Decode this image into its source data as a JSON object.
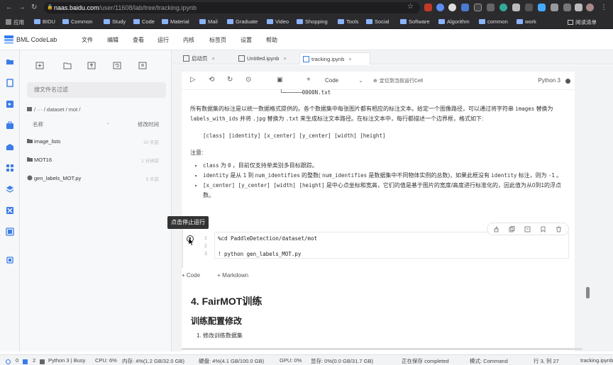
{
  "browser": {
    "url_host": "naas.baidu.com",
    "url_path": "/user/11608/lab/tree/tracking.ipynb",
    "bookmarks": [
      "应用",
      "BIDU",
      "Common",
      "Study",
      "Code",
      "Material",
      "Mail",
      "Graduate",
      "Video",
      "Shopping",
      "Tools",
      "Social",
      "Software",
      "Algorithm",
      "common",
      "work"
    ],
    "reading_list": "阅读清单"
  },
  "app": {
    "title": "BML CodeLab",
    "menu": [
      "文件",
      "编辑",
      "查看",
      "运行",
      "内核",
      "标签页",
      "设置",
      "帮助"
    ]
  },
  "filebrowser": {
    "search_placeholder": "搜文件名过滤",
    "breadcrumb": "/ ··· / dataset / mot /",
    "col_name": "名称",
    "col_modified": "修改时间",
    "items": [
      {
        "name": "image_lists",
        "time": "10 天前"
      },
      {
        "name": "MOT16",
        "time": "1 分钟前"
      },
      {
        "name": "gen_labels_MOT.py",
        "time": "5 天前"
      }
    ]
  },
  "tabs": [
    {
      "label": "启动页"
    },
    {
      "label": "Untitled.ipynb"
    },
    {
      "label": "tracking.ipynb"
    }
  ],
  "toolbar": {
    "cell_type": "Code",
    "run_current": "定位到当前运行Cell",
    "kernel": "Python 3"
  },
  "markdown1": {
    "tree_tail": "└──────0000N.txt",
    "para_a": "所有数据集的标注是以统一数据格式提供的。各个数据集中每张图片都有相应的标注文本。给定一个图像路径，可以通过将字符串",
    "code_images": "images",
    "para_b": "替换为",
    "code_lwi": "labels_with_ids",
    "para_c": "并将",
    "code_jpg": ".jpg",
    "para_d": "替换为",
    "code_txt": ".txt",
    "para_e": "来生成标注文本路径。在标注文本中，每行都描述一个边界框，格式如下:",
    "format_line": "[class] [identity] [x_center] [y_center] [width] [height]",
    "note": "注意:",
    "bullet1_code": "class",
    "bullet1_mid": "为",
    "bullet1_code2": "0",
    "bullet1_tail": "，目前仅支持单类别多目标跟踪。",
    "bullet2_code": "identity",
    "bullet2_a": "是从",
    "bullet2_code2": "1",
    "bullet2_b": "到",
    "bullet2_code3": "num_identifies",
    "bullet2_c": "的整数(",
    "bullet2_code4": "num_identifies",
    "bullet2_d": "是数据集中不同物体实例的总数)，如果此框没有",
    "bullet2_code5": "identity",
    "bullet2_e": "标注，则为",
    "bullet2_code6": "-1",
    "bullet2_f": "。",
    "bullet3_code": "[x_center] [y_center] [width] [height]",
    "bullet3_tail": "是中心点坐标和宽高，它们的值是基于图片的宽度/高度进行标准化的，因此值为从0到1的浮点数。"
  },
  "codecell": {
    "lines": [
      "%cd PaddleDetection/dataset/mot",
      "",
      "! python gen_labels_MOT.py"
    ],
    "line_numbers": [
      "1",
      "2",
      "3"
    ],
    "tooltip": "点击停止运行"
  },
  "add_bar": {
    "code": "+ Code",
    "markdown": "+ Markdown"
  },
  "markdown2": {
    "h_fairmot": "4. FairMOT训练",
    "h_config": "训练配置修改",
    "item1": "1. 修改训练数据集"
  },
  "status": {
    "zero": "0",
    "two": "2",
    "kernel": "Python 3 | Busy",
    "cpu": "CPU:  6%",
    "mem": "内存:  4%(1.2 GB/32.0 GB)",
    "disk": "硬盘:  4%(4.1 GB/100.0 GB)",
    "gpu": "GPU:  0%",
    "vram": "显存:  0%(0.0 GB/31.7 GB)",
    "saving": "正在保存 completed",
    "mode": "模式:  Command",
    "cursor": "行 3, 列 27",
    "file": "tracking.ipynb"
  }
}
